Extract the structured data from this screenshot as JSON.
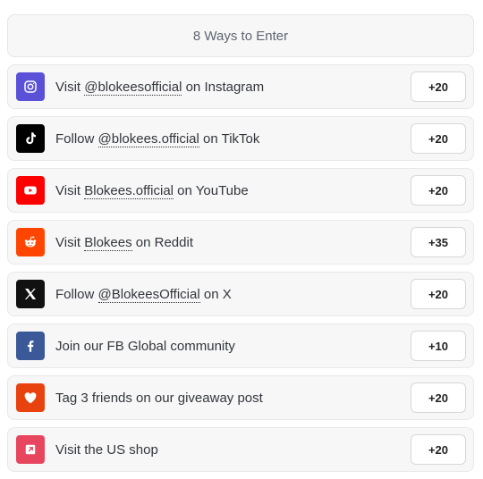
{
  "header": {
    "title": "8 Ways to Enter"
  },
  "entries": [
    {
      "pre": "Visit ",
      "link": "@blokeesofficial",
      "post": " on Instagram",
      "points": "+20",
      "icon": "instagram-icon",
      "color": "#5b51d8"
    },
    {
      "pre": "Follow ",
      "link": "@blokees.official",
      "post": " on TikTok",
      "points": "+20",
      "icon": "tiktok-icon",
      "color": "#000000"
    },
    {
      "pre": "Visit ",
      "link": "Blokees.official",
      "post": " on YouTube",
      "points": "+20",
      "icon": "youtube-icon",
      "color": "#ff0000"
    },
    {
      "pre": "Visit ",
      "link": "Blokees",
      "post": " on Reddit",
      "points": "+35",
      "icon": "reddit-icon",
      "color": "#ff4500"
    },
    {
      "pre": "Follow ",
      "link": "@BlokeesOfficial",
      "post": " on X",
      "points": "+20",
      "icon": "x-icon",
      "color": "#111111"
    },
    {
      "pre": "Join our FB Global community",
      "link": "",
      "post": "",
      "points": "+10",
      "icon": "facebook-icon",
      "color": "#3b5998"
    },
    {
      "pre": "Tag 3 friends on our giveaway post",
      "link": "",
      "post": "",
      "points": "+20",
      "icon": "heart-icon",
      "color": "#e8420e"
    },
    {
      "pre": "Visit the US shop",
      "link": "",
      "post": "",
      "points": "+20",
      "icon": "external-link-icon",
      "color": "#e8455e"
    }
  ]
}
